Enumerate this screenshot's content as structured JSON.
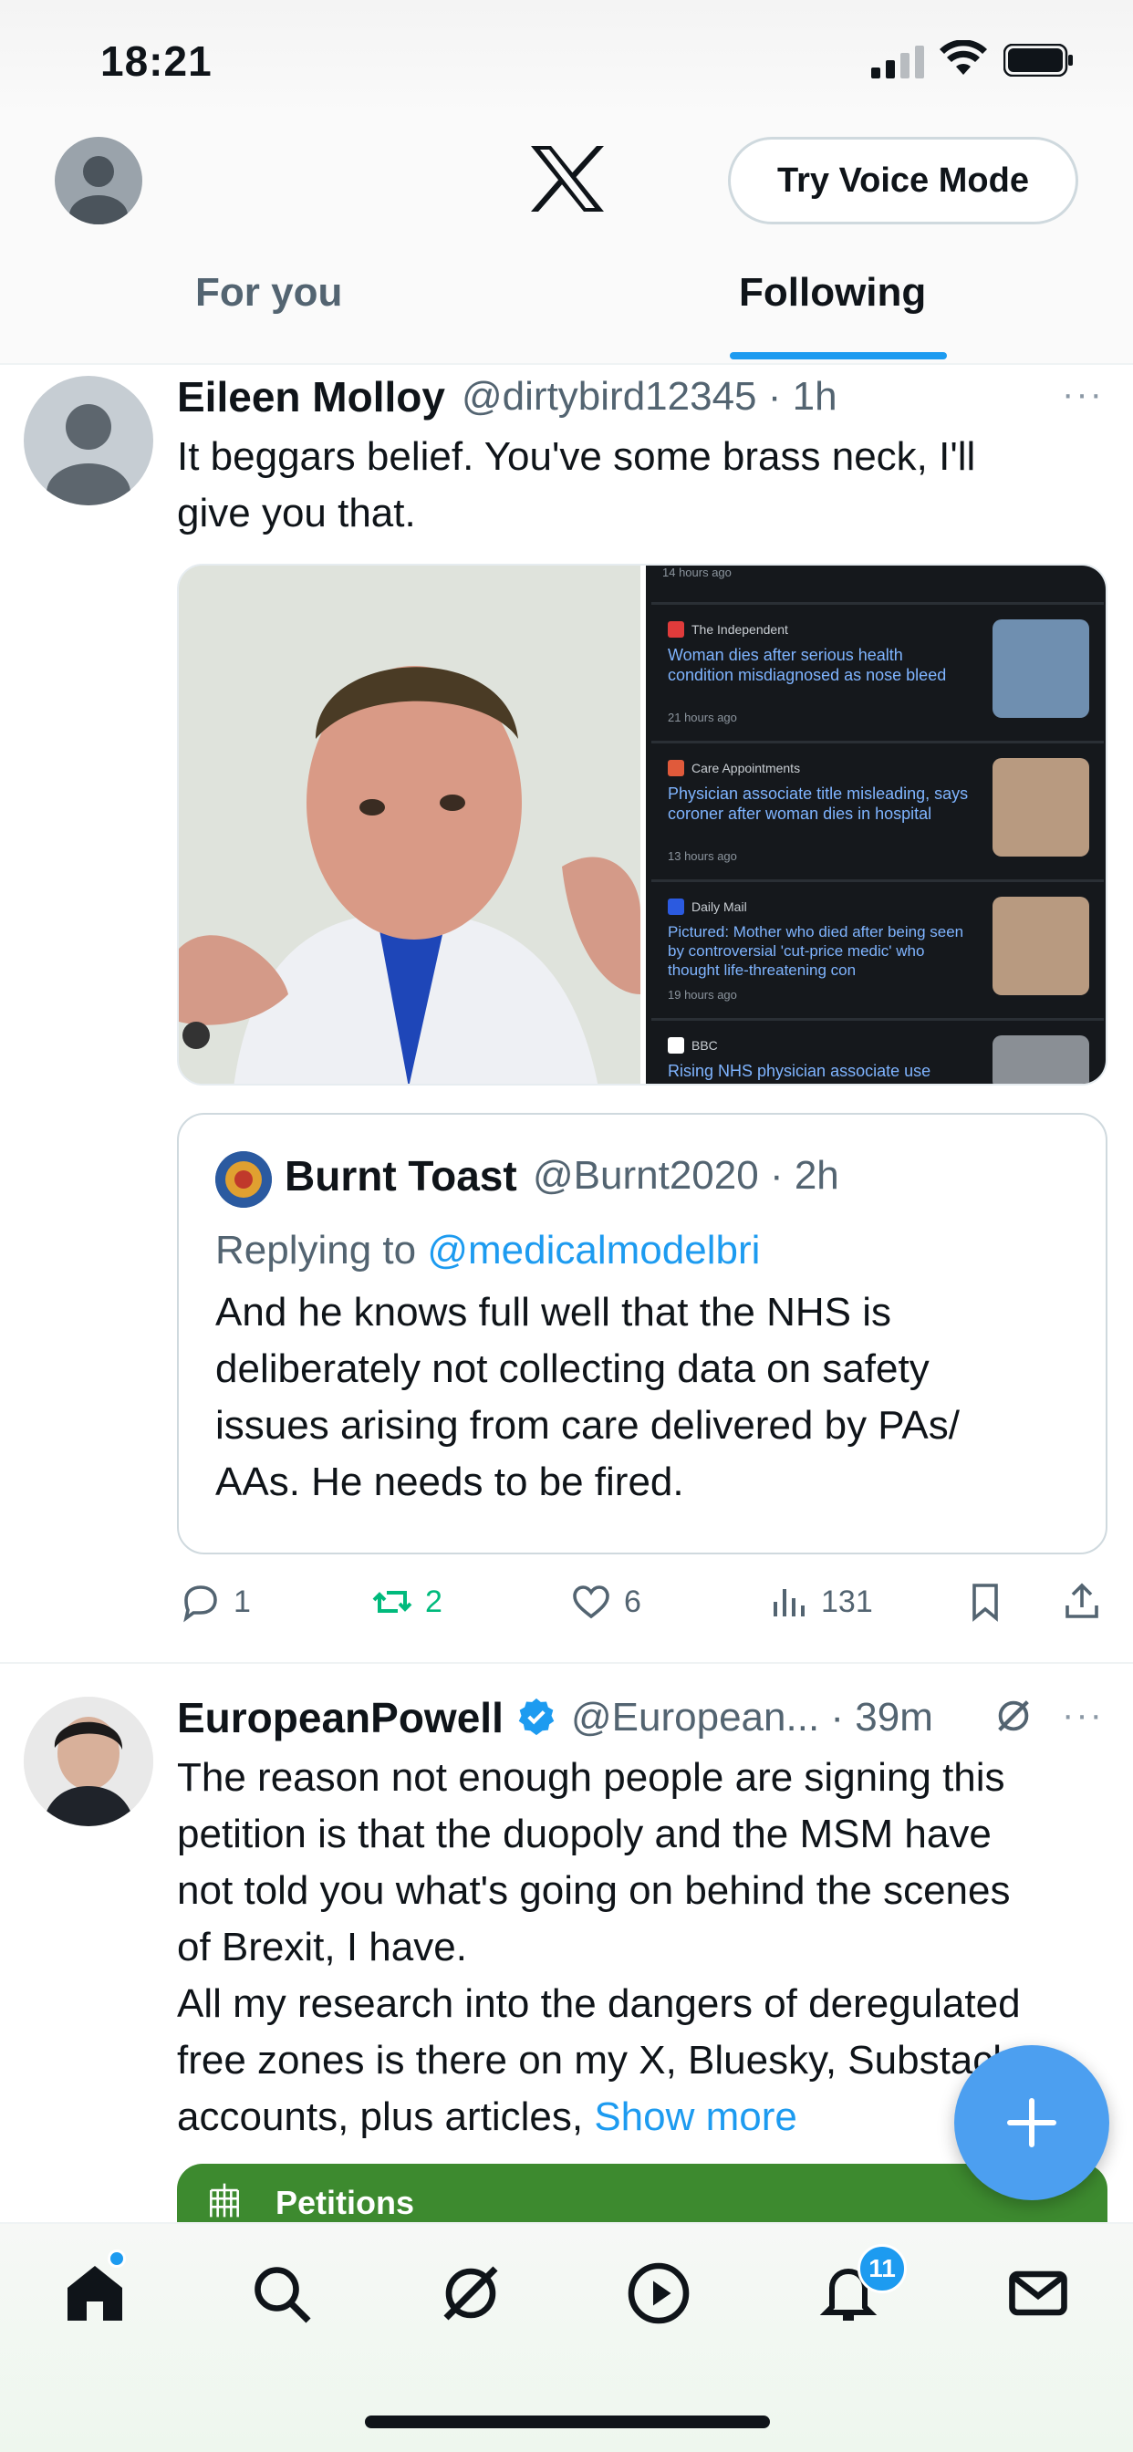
{
  "status": {
    "time": "18:21"
  },
  "header": {
    "voice_button": "Try Voice Mode",
    "tabs": [
      {
        "label": "For you"
      },
      {
        "label": "Following"
      }
    ]
  },
  "post1": {
    "name": "Eileen Molloy",
    "handle": "@dirtybird12345",
    "time": "· 1h",
    "more": "···",
    "text_line1": "It beggars belief. You've some brass neck, I'll",
    "text_line2": "give you that.",
    "news": [
      {
        "source": "The Independent",
        "title": "Woman dies after serious health condition misdiagnosed as nose bleed",
        "time": "21 hours ago",
        "color": "#e03b3b"
      },
      {
        "source": "Care Appointments",
        "title": "Physician associate title misleading, says coroner after woman dies in hospital",
        "time": "13 hours ago",
        "color": "#e05a3b"
      },
      {
        "source": "Daily Mail",
        "title": "Pictured: Mother who died after being seen by controversial 'cut-price medic' who thought life-threatening con",
        "time": "19 hours ago",
        "color": "#2b5ae0"
      },
      {
        "source": "BBC",
        "title": "Rising NHS physician associate use",
        "time": "",
        "color": "#ffffff"
      }
    ],
    "news_top_time": "14 hours ago",
    "quote": {
      "name": "Burnt Toast",
      "handle": "@Burnt2020",
      "time": "· 2h",
      "replying_prefix": "Replying to ",
      "replying_to": "@medicalmodelbri",
      "lines": [
        "And he knows full well that the NHS is",
        "deliberately not collecting data on safety",
        "issues arising from care delivered by PAs/",
        "AAs. He needs to be fired."
      ]
    },
    "actions": {
      "replies": "1",
      "reposts": "2",
      "likes": "6",
      "views": "131"
    }
  },
  "post2": {
    "name": "EuropeanPowell",
    "handle": "@European...",
    "time": "· 39m",
    "more": "···",
    "lines": [
      "The reason not enough people are signing this",
      "petition is that the duopoly and the MSM have",
      "not told you what's going on behind the scenes",
      "of Brexit, I have.",
      "All my research into the dangers of deregulated",
      "free zones is there on my X, Bluesky, Substack",
      "accounts, plus articles, "
    ],
    "show_more": "Show more",
    "card_label": "Petitions"
  },
  "nav": {
    "notifications_badge": "11"
  },
  "colors": {
    "accent": "#1d9bf0",
    "repost_green": "#00ba7c",
    "petitions_green": "#3d8a2f"
  }
}
